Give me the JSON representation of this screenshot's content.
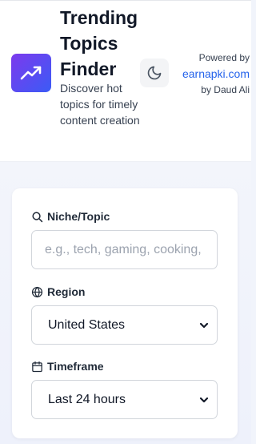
{
  "header": {
    "title": "Trending Topics Finder",
    "subtitle": "Discover hot topics for timely content creation",
    "powered_by": "Powered by",
    "site_link": "earnapki.com",
    "byline": "by Daud Ali"
  },
  "form": {
    "niche": {
      "label": "Niche/Topic",
      "placeholder": "e.g., tech, gaming, cooking, fitness",
      "value": ""
    },
    "region": {
      "label": "Region",
      "selected": "United States"
    },
    "timeframe": {
      "label": "Timeframe",
      "selected": "Last 24 hours"
    }
  },
  "colors": {
    "brand_gradient_start": "#7c3aed",
    "brand_gradient_end": "#3b5bf6",
    "link": "#2563eb"
  },
  "icons": {
    "logo": "trending-up-icon",
    "theme_toggle": "moon-icon",
    "niche": "search-icon",
    "region": "globe-icon",
    "timeframe": "calendar-icon",
    "select_arrow": "chevron-down-icon"
  }
}
